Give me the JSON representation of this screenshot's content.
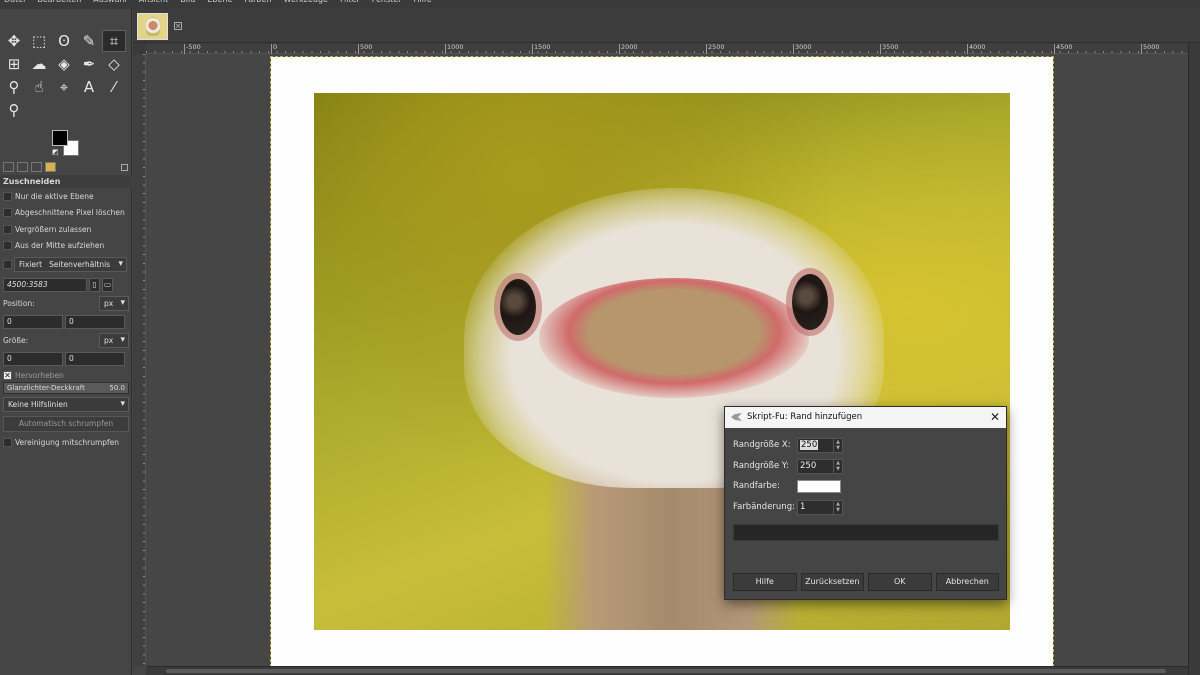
{
  "menu": [
    "Datei",
    "Bearbeiten",
    "Auswahl",
    "Ansicht",
    "Bild",
    "Ebene",
    "Farben",
    "Werkzeuge",
    "Filter",
    "Fenster",
    "Hilfe"
  ],
  "tools": [
    {
      "icon": "move-icon",
      "glyph": "✥"
    },
    {
      "icon": "rect-select-icon",
      "glyph": "⬚"
    },
    {
      "icon": "lasso-icon",
      "glyph": "ʘ"
    },
    {
      "icon": "fuzzy-select-icon",
      "glyph": "✎"
    },
    {
      "icon": "crop-icon",
      "glyph": "⌗"
    },
    {
      "icon": "unified-transform-icon",
      "glyph": "⊞"
    },
    {
      "icon": "warp-icon",
      "glyph": "☁"
    },
    {
      "icon": "bucket-fill-icon",
      "glyph": "◈"
    },
    {
      "icon": "paintbrush-icon",
      "glyph": "✒"
    },
    {
      "icon": "eraser-icon",
      "glyph": "◇"
    },
    {
      "icon": "clone-icon",
      "glyph": "⚲"
    },
    {
      "icon": "smudge-icon",
      "glyph": "☝"
    },
    {
      "icon": "paths-icon",
      "glyph": "⌖"
    },
    {
      "icon": "text-icon",
      "glyph": "A"
    },
    {
      "icon": "color-picker-icon",
      "glyph": "⁄"
    },
    {
      "icon": "zoom-icon",
      "glyph": "⚲"
    }
  ],
  "tool_options": {
    "title": "Zuschneiden",
    "checks": [
      {
        "label": "Nur die aktive Ebene",
        "checked": false
      },
      {
        "label": "Abgeschnittene Pixel löschen",
        "checked": false
      },
      {
        "label": "Vergrößern zulassen",
        "checked": false
      },
      {
        "label": "Aus der Mitte aufziehen",
        "checked": false
      }
    ],
    "fixed_label": "Fixiert",
    "fixed_select": "Seitenverhältnis",
    "ratio_value": "4500:3583",
    "position_label": "Position:",
    "position_unit": "px",
    "position_x": "0",
    "position_y": "0",
    "size_label": "Größe:",
    "size_unit": "px",
    "size_x": "0",
    "size_y": "0",
    "highlight_label": "Hervorheben",
    "opacity_label": "Glanzlichter-Deckkraft",
    "opacity_value": "50.0",
    "guides_select": "Keine Hilfslinien",
    "auto_shrink_button": "Automatisch schrumpfen",
    "shrink_merged_label": "Vereinigung mitschrumpfen"
  },
  "ruler_ticks": [
    "-500",
    "0",
    "500",
    "1000",
    "1500",
    "2000",
    "2500",
    "3000",
    "3500",
    "4000",
    "4500",
    "5000"
  ],
  "dialog": {
    "title": "Skript-Fu: Rand hinzufügen",
    "size_x_label": "Randgröße X:",
    "size_x_value": "250",
    "size_y_label": "Randgröße Y:",
    "size_y_value": "250",
    "color_label": "Randfarbe:",
    "color_value": "#ffffff",
    "delta_label": "Farbänderung:",
    "delta_value": "1",
    "buttons": {
      "help": "Hilfe",
      "reset": "Zurücksetzen",
      "ok": "OK",
      "cancel": "Abbrechen"
    }
  }
}
